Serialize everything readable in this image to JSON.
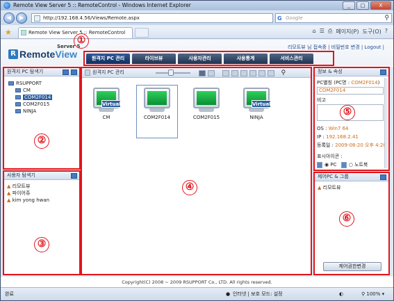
{
  "window": {
    "title": "Remote View Server 5 :: RemoteControl - Windows Internet Explorer",
    "minimize": "_",
    "maximize": "□",
    "close": "X"
  },
  "browser": {
    "back_icon": "back-arrow-icon",
    "forward_icon": "forward-arrow-icon",
    "url": "http://192.168.4.56/Views/Remote.aspx",
    "search_brand": "G",
    "search_placeholder": "Google",
    "tab_label": "Remote View Server 5 :: RemoteControl",
    "cmd": {
      "page": "페이지(P)",
      "tools": "도구(O)"
    }
  },
  "app": {
    "logo_r": "R",
    "logo_remote": "Remote",
    "logo_view": "View",
    "server_label": "Server 5",
    "user_line": "리모트뷰 님 접속중 | 비밀번호 변경 | Logout |",
    "menu": [
      {
        "label": "원격지 PC 관리"
      },
      {
        "label": "라이브뷰"
      },
      {
        "label": "사용자관리"
      },
      {
        "label": "사용통계"
      },
      {
        "label": "서비스관리"
      }
    ]
  },
  "panels": {
    "pc_explorer": {
      "title": "원격지 PC 탐색기",
      "root": "RSUPPORT",
      "items": [
        "CM",
        "COM2F014",
        "COM2F015",
        "NINJA"
      ]
    },
    "user_explorer": {
      "title": "사용자 탐색기",
      "items": [
        "리모트뷰",
        "파이어쥬",
        "kim yong hwan"
      ]
    },
    "pc_manage": {
      "title": "원격지 PC 관리",
      "pcs": [
        {
          "name": "CM",
          "virtual": "Virtual"
        },
        {
          "name": "COM2F014",
          "virtual": ""
        },
        {
          "name": "COM2F015",
          "virtual": ""
        },
        {
          "name": "NINJA",
          "virtual": "Virtual"
        }
      ]
    },
    "info": {
      "title": "정보 & 속성",
      "alias_label": "PC별칭 (PC명 : ",
      "alias_name": "COM2F014",
      "alias_close": ")",
      "alias_value": "COM2F014",
      "memo_label": "비고",
      "os_label": "OS : ",
      "os_value": "Win7 64",
      "ip_label": "IP : ",
      "ip_value": "192.168.2.41",
      "reg_label": "등록일 : ",
      "reg_value": "2009-08-20 오후 4:20",
      "icon_label": "표시아이콘 :",
      "radio_pc": "PC",
      "radio_notebook": "노트북"
    },
    "control_group": {
      "title": "제어PC & 그룹",
      "items": [
        "리모트뷰"
      ],
      "button": "제어권한변경"
    }
  },
  "annotations": [
    "①",
    "②",
    "③",
    "④",
    "⑤",
    "⑥"
  ],
  "footer": "Copyright(C) 2008 ~ 2009 RSUPPORT Co., LTD. All rights reserved.",
  "status": {
    "left": "완료",
    "zone": "인터넷 | 보호 모드: 설정",
    "zoom": "100%"
  }
}
